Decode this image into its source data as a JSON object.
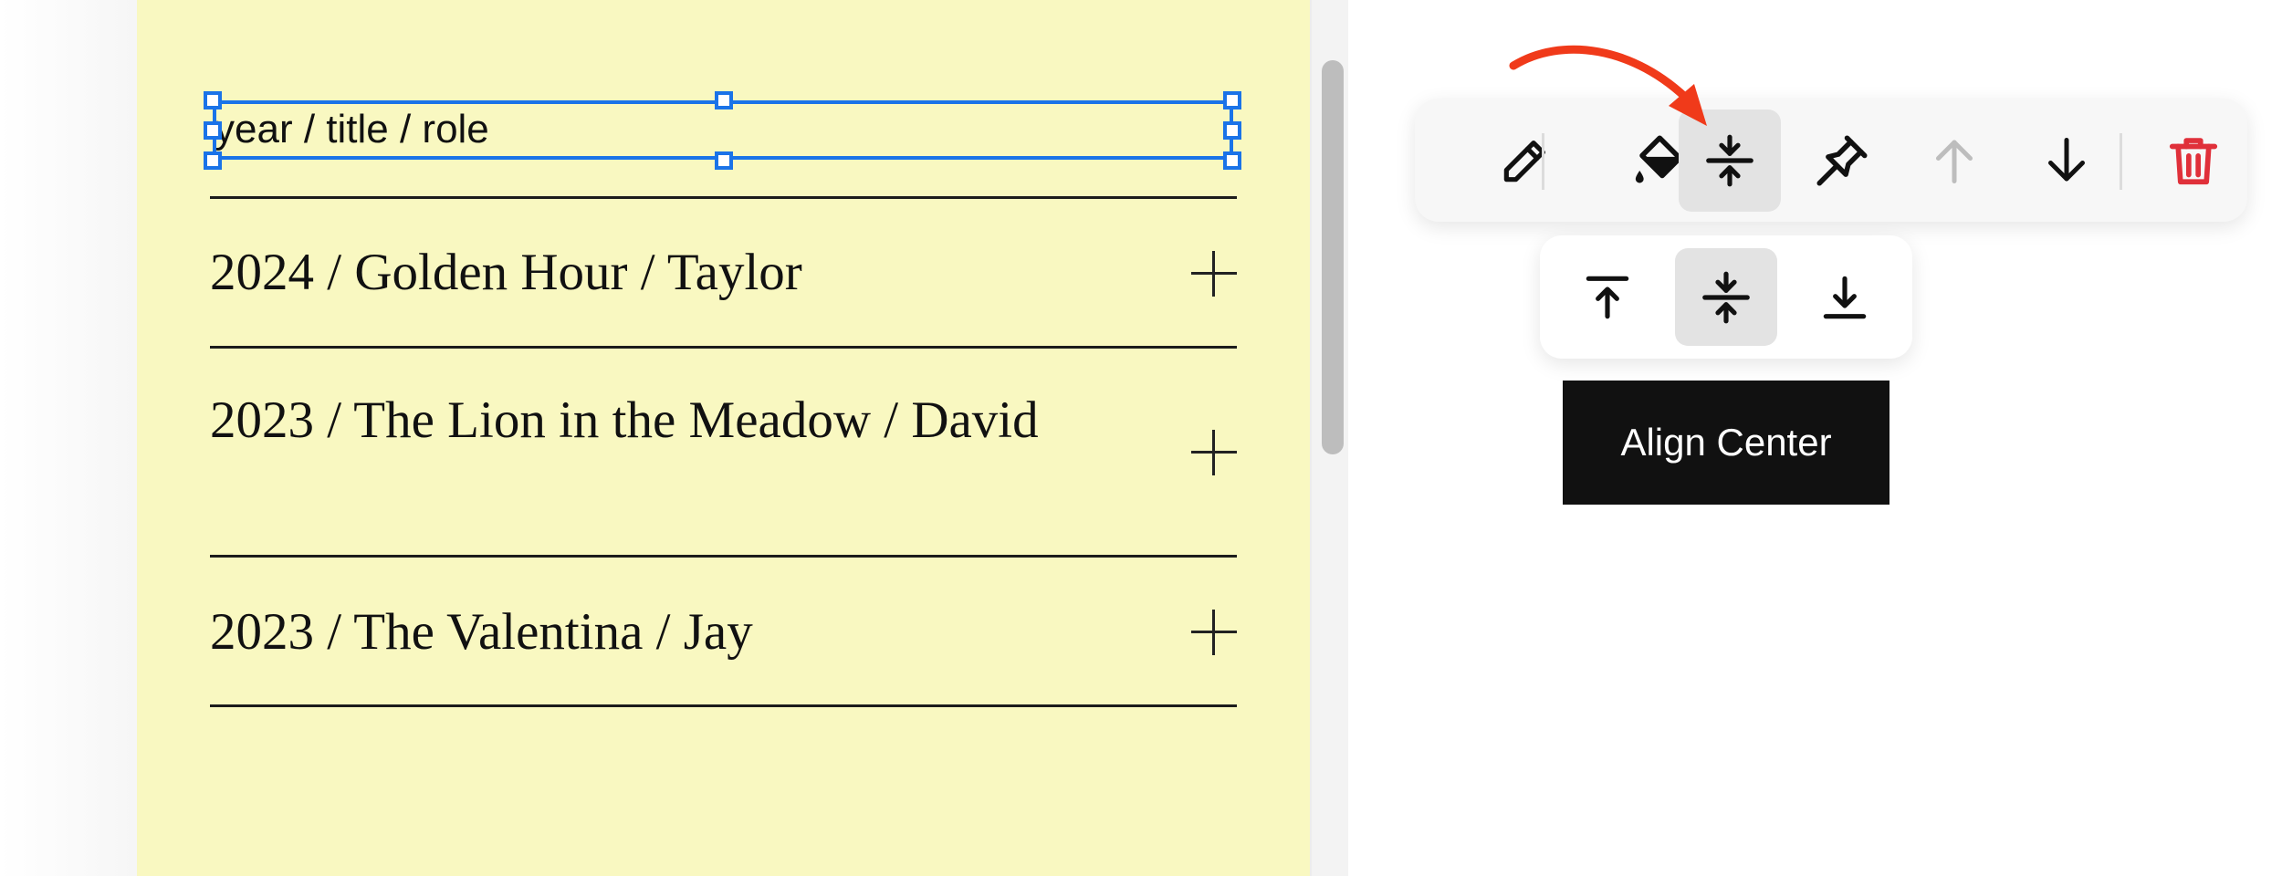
{
  "editor": {
    "selected_text": "year / title / role",
    "list_items": [
      {
        "title": "2024 / Golden Hour / Taylor"
      },
      {
        "title": "2023 / The Lion in the Meadow / David"
      },
      {
        "title": "2023 / The Valentina / Jay"
      }
    ]
  },
  "toolbar": {
    "buttons": [
      {
        "icon": "pencil-icon",
        "name": "edit"
      },
      {
        "icon": "paint-bucket-icon",
        "name": "fill"
      },
      {
        "icon": "align-center-icon",
        "name": "align",
        "active": true
      },
      {
        "icon": "pin-icon",
        "name": "pin"
      },
      {
        "icon": "arrow-up-icon",
        "name": "move-up",
        "disabled": true
      },
      {
        "icon": "arrow-down-icon",
        "name": "move-down"
      },
      {
        "icon": "trash-icon",
        "name": "delete",
        "color": "#e0303a"
      }
    ]
  },
  "align_menu": {
    "options": [
      {
        "icon": "align-top-icon",
        "name": "top"
      },
      {
        "icon": "align-center-icon",
        "name": "center",
        "active": true
      },
      {
        "icon": "align-bottom-icon",
        "name": "bottom"
      }
    ],
    "tooltip": "Align Center"
  },
  "colors": {
    "page_bg": "#f9f8c1",
    "selection": "#1a73e8",
    "annotation_arrow": "#f03a1a",
    "delete": "#e0303a"
  }
}
